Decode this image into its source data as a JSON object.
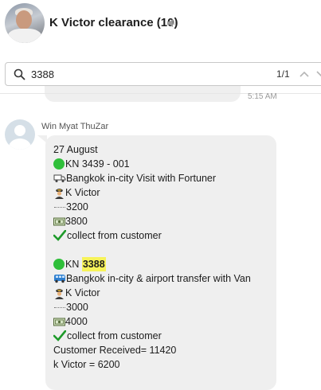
{
  "header": {
    "title": "K Victor clearance (10)",
    "avatar_icon": "group-photo-avatar",
    "mute_icon": "speaker-muted-icon"
  },
  "search": {
    "value": "3388",
    "result_count": "1/1"
  },
  "previous_message": {
    "time": "5:15 AM"
  },
  "message": {
    "sender": "Win Myat ThuZar",
    "lines": {
      "date": "27 August",
      "kn1": "KN 3439 - 001",
      "service1": " Bangkok in-city Visit with Fortuner",
      "driver1": "K Victor",
      "cost1": "3200",
      "price1": " 3800",
      "collect1": "collect from customer",
      "kn2_prefix": "KN ",
      "kn2_highlight": "3388",
      "service2": " Bangkok in-city & airport transfer with Van",
      "driver2": "K Victor",
      "cost2": "3000",
      "price2": "4000",
      "collect2": "collect from customer",
      "received": "Customer Received= 11420",
      "victor_total": "k Victor = 6200"
    }
  },
  "colors": {
    "green_circle": "#2fbf3a",
    "highlight": "#f7f35a",
    "bubble": "#efefef"
  }
}
